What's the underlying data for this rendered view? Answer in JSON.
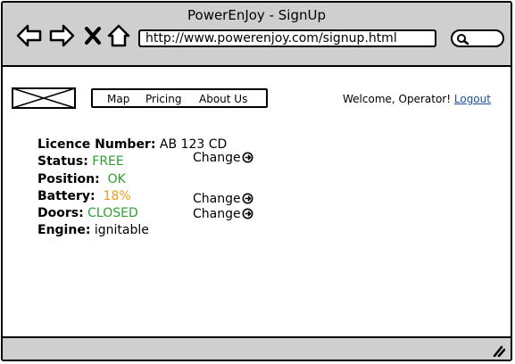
{
  "window": {
    "title": "PowerEnJoy - SignUp"
  },
  "browser": {
    "url": "http://www.powerenjoy.com/signup.html",
    "icons": [
      "back-arrow-icon",
      "forward-arrow-icon",
      "stop-icon",
      "home-icon",
      "search-icon"
    ]
  },
  "header": {
    "menu": [
      "Map",
      "Pricing",
      "About Us"
    ],
    "welcome_text": "Welcome, Operator!",
    "logout_label": "Logout"
  },
  "car": {
    "licence_label": "Licence Number:",
    "licence_value": "AB 123 CD",
    "status_label": "Status:",
    "status_value": "FREE",
    "position_label": "Position:",
    "position_value": "OK",
    "battery_label": "Battery:",
    "battery_value": "18%",
    "doors_label": "Doors:",
    "doors_value": "CLOSED",
    "engine_label": "Engine:",
    "engine_value": "ignitable"
  },
  "actions": {
    "change_label": "Change"
  },
  "colors": {
    "ok_green": "#2fa02f",
    "warning_orange": "#f39a1b",
    "link_blue": "#1a4f9c",
    "chrome_gray": "#cfcfcf"
  }
}
